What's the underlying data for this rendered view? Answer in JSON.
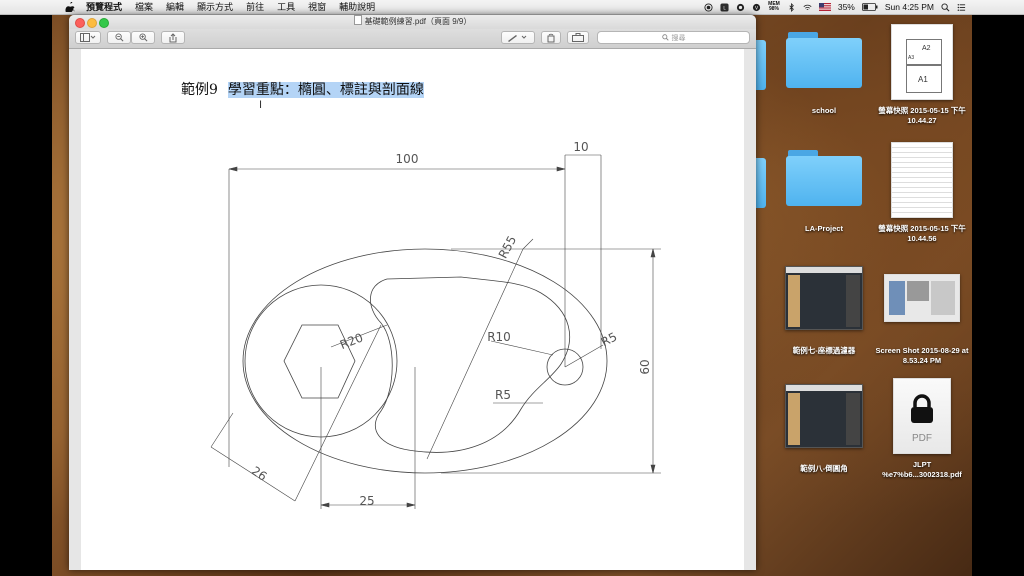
{
  "menubar": {
    "app_name": "預覽程式",
    "items": [
      "檔案",
      "編輯",
      "顯示方式",
      "前往",
      "工具",
      "視窗",
      "輔助說明"
    ],
    "mem_line1": "MEM",
    "mem_line2": "98%",
    "battery": "35%",
    "clock": "Sun 4:25 PM"
  },
  "window": {
    "title": "基礎範例練習.pdf（頁面 9/9）",
    "search_placeholder": "搜尋"
  },
  "document": {
    "heading_prefix": "範例9",
    "heading_selected": "學習重點：橢圓、標註與剖面線",
    "dimensions": {
      "d100": "100",
      "d10": "10",
      "r55": "R55",
      "r20": "R20",
      "r10": "R10",
      "r5_top": "R5",
      "r5_bottom": "R5",
      "d60": "60",
      "d26": "26",
      "d25": "25"
    }
  },
  "desktop": {
    "items": [
      {
        "label": "school",
        "kind": "folder"
      },
      {
        "label": "螢幕快照 2015-05-15 下午10.44.27",
        "kind": "thumb-a"
      },
      {
        "label": "LA-Project",
        "kind": "folder"
      },
      {
        "label": "螢幕快照 2015-05-15 下午10.44.56",
        "kind": "thumb-table"
      },
      {
        "label": "範例七-座標過濾器",
        "kind": "thumb-dark"
      },
      {
        "label": "Screen Shot 2015-08-29 at 8.53.24 PM",
        "kind": "thumb-web"
      },
      {
        "label": "範例八-倒圓角",
        "kind": "thumb-dark"
      },
      {
        "label": "JLPT %e7%b6...3002318.pdf",
        "kind": "pdf"
      }
    ],
    "thumb_text": {
      "a2": "A2",
      "a3": "A3",
      "a1": "A1",
      "pdf": "PDF"
    }
  }
}
